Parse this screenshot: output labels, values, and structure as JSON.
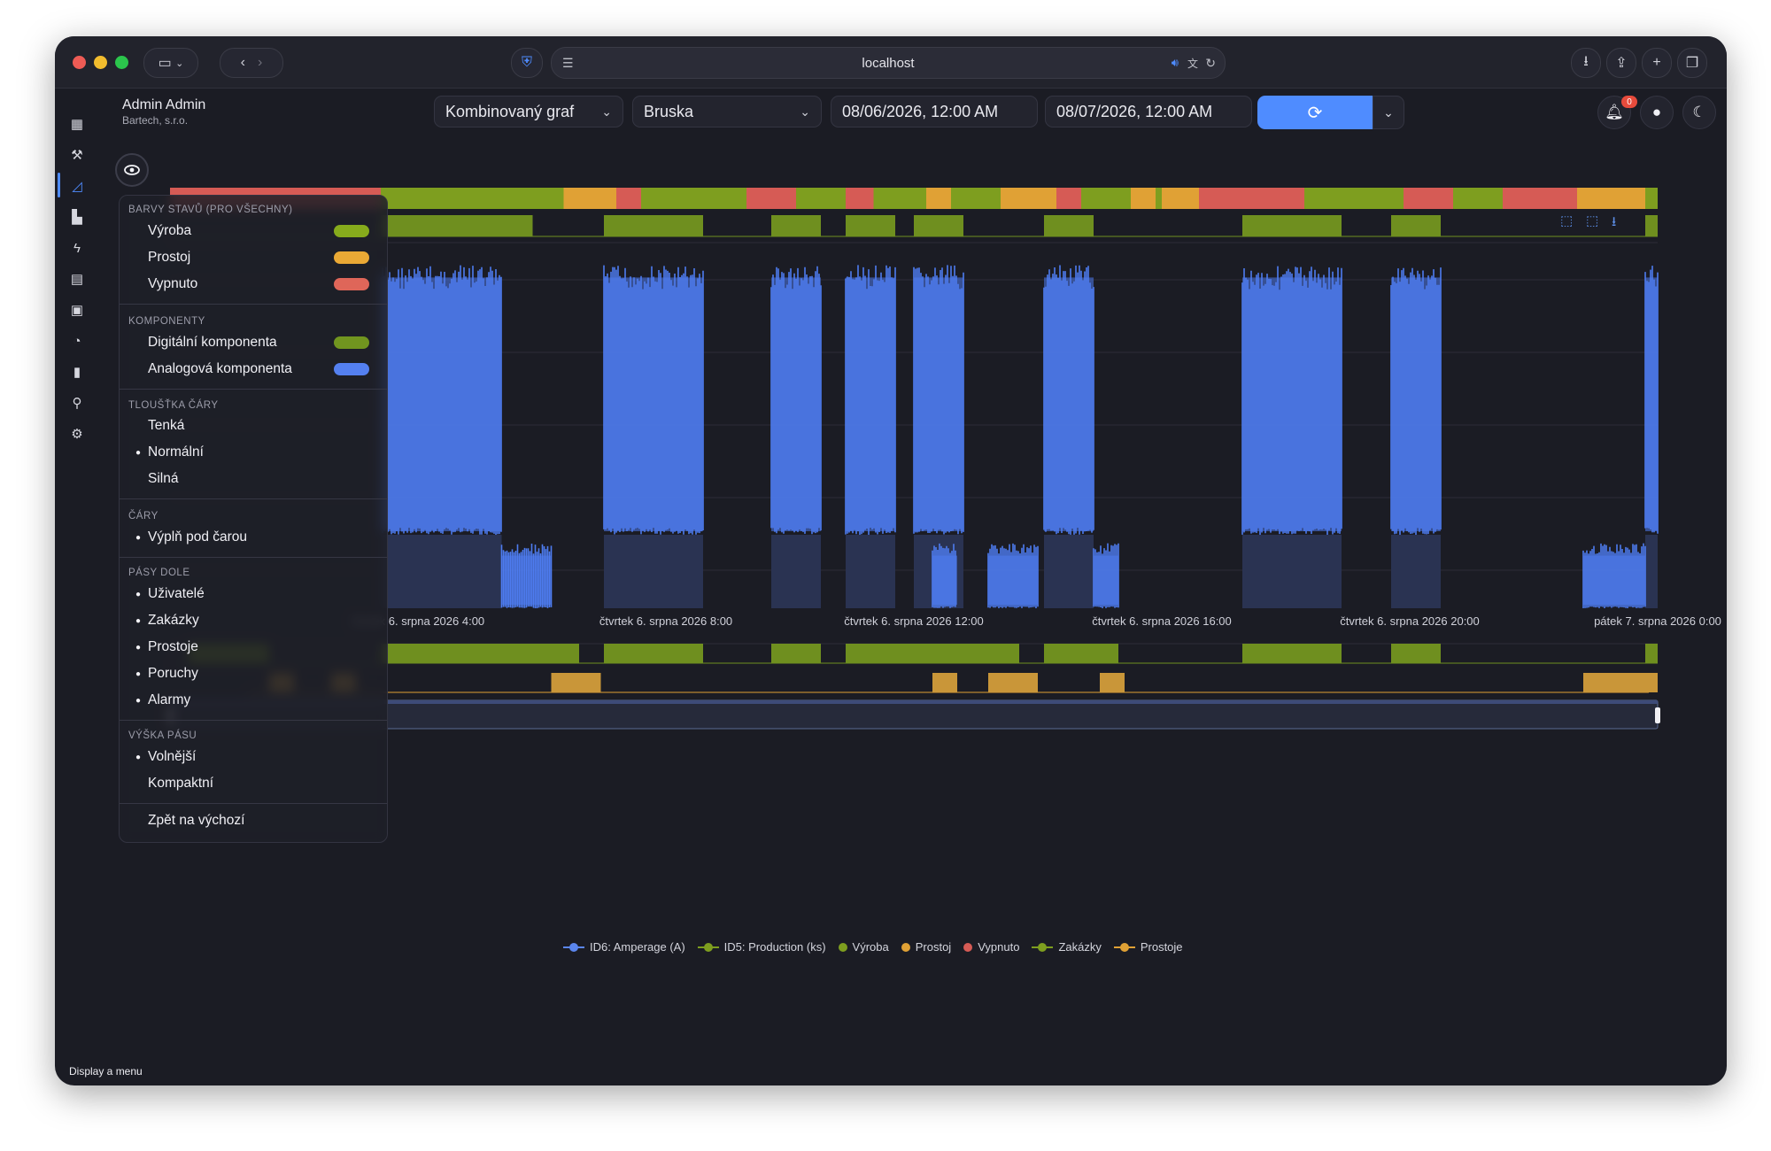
{
  "browser": {
    "url": "localhost"
  },
  "user": {
    "name": "Admin Admin",
    "company": "Bartech, s.r.o."
  },
  "toolbar": {
    "chart_type": "Kombinovaný graf",
    "machine": "Bruska",
    "date_from": "08/06/2026, 12:00 AM",
    "date_to": "08/07/2026, 12:00 AM",
    "notification_count": "0"
  },
  "colors": {
    "vyroba": "#7e9e1f",
    "prostoj": "#e0a135",
    "vypnuto": "#d65b55",
    "digital": "#6f8f1f",
    "analog": "#4e7cf0",
    "accent": "#4f8cff"
  },
  "menu": {
    "section_state_colors": "BARVY STAVŮ (PRO VŠECHNY)",
    "state_vyroba": "Výroba",
    "state_prostoj": "Prostoj",
    "state_vypnuto": "Vypnuto",
    "section_components": "KOMPONENTY",
    "comp_digital": "Digitální komponenta",
    "comp_analog": "Analogová komponenta",
    "section_line_width": "TLOUŠŤKA ČÁRY",
    "lw_thin": "Tenká",
    "lw_normal": "Normální",
    "lw_strong": "Silná",
    "section_lines": "ČÁRY",
    "lines_fill": "Výplň pod čarou",
    "section_bottom_bands": "PÁSY DOLE",
    "band_users": "Uživatelé",
    "band_orders": "Zakázky",
    "band_downtimes": "Prostoje",
    "band_failures": "Poruchy",
    "band_alarms": "Alarmy",
    "section_band_height": "VÝŠKA PÁSU",
    "bh_loose": "Volnější",
    "bh_compact": "Kompaktní",
    "reset": "Zpět na výchozí"
  },
  "chart_data": {
    "type": "area",
    "x_ticks": [
      "čtvrtek 6. srpna 2026 4:00",
      "čtvrtek 6. srpna 2026 8:00",
      "čtvrtek 6. srpna 2026 12:00",
      "čtvrtek 6. srpna 2026 16:00",
      "čtvrtek 6. srpna 2026 20:00",
      "pátek 7. srpna 2026 0:00"
    ],
    "x_range_hours": [
      0,
      24
    ],
    "state_band": [
      {
        "state": "vypnuto",
        "start": 0.0,
        "end": 3.4
      },
      {
        "state": "vyroba",
        "start": 3.4,
        "end": 6.35
      },
      {
        "state": "prostoj",
        "start": 6.35,
        "end": 7.2
      },
      {
        "state": "vypnuto",
        "start": 7.2,
        "end": 7.6
      },
      {
        "state": "vyroba",
        "start": 7.6,
        "end": 9.3
      },
      {
        "state": "vypnuto",
        "start": 9.3,
        "end": 10.1
      },
      {
        "state": "vyroba",
        "start": 10.1,
        "end": 10.9
      },
      {
        "state": "vypnuto",
        "start": 10.9,
        "end": 11.35
      },
      {
        "state": "vyroba",
        "start": 11.35,
        "end": 12.2
      },
      {
        "state": "prostoj",
        "start": 12.2,
        "end": 12.6
      },
      {
        "state": "vyroba",
        "start": 12.6,
        "end": 13.4
      },
      {
        "state": "prostoj",
        "start": 13.4,
        "end": 14.3
      },
      {
        "state": "vypnuto",
        "start": 14.3,
        "end": 14.7
      },
      {
        "state": "vyroba",
        "start": 14.7,
        "end": 15.5
      },
      {
        "state": "prostoj",
        "start": 15.5,
        "end": 15.9
      },
      {
        "state": "vyroba",
        "start": 15.9,
        "end": 16.0
      },
      {
        "state": "prostoj",
        "start": 16.0,
        "end": 16.6
      },
      {
        "state": "vypnuto",
        "start": 16.6,
        "end": 18.3
      },
      {
        "state": "vyroba",
        "start": 18.3,
        "end": 19.9
      },
      {
        "state": "vypnuto",
        "start": 19.9,
        "end": 20.7
      },
      {
        "state": "vyroba",
        "start": 20.7,
        "end": 21.5
      },
      {
        "state": "vypnuto",
        "start": 21.5,
        "end": 22.7
      },
      {
        "state": "prostoj",
        "start": 22.7,
        "end": 23.8
      },
      {
        "state": "vyroba",
        "start": 23.8,
        "end": 24.0
      }
    ],
    "production_blocks": [
      [
        3.4,
        5.85
      ],
      [
        7.0,
        8.6
      ],
      [
        9.7,
        10.5
      ],
      [
        10.9,
        11.7
      ],
      [
        12.0,
        12.8
      ],
      [
        14.1,
        14.9
      ],
      [
        17.3,
        18.9
      ],
      [
        19.7,
        20.5
      ],
      [
        23.8,
        24.0
      ]
    ],
    "series": [
      {
        "name": "ID6: Amperage (A)",
        "high_bursts": [
          [
            3.4,
            5.35
          ],
          [
            7.0,
            8.6
          ],
          [
            9.7,
            10.5
          ],
          [
            10.9,
            11.7
          ],
          [
            12.0,
            12.8
          ],
          [
            14.1,
            14.9
          ],
          [
            17.3,
            18.9
          ],
          [
            19.7,
            20.5
          ],
          [
            23.8,
            24.0
          ]
        ],
        "high_level": 95,
        "low_bursts": [
          [
            5.35,
            6.15
          ],
          [
            12.3,
            12.7
          ],
          [
            13.2,
            14.0
          ],
          [
            14.9,
            15.3
          ],
          [
            22.8,
            23.8
          ]
        ],
        "low_level": 18
      },
      {
        "name": "ID5: Production (ks)"
      }
    ],
    "bottom_orders": [
      [
        0.3,
        1.6
      ],
      [
        3.4,
        6.6
      ],
      [
        7.0,
        8.6
      ],
      [
        9.7,
        10.5
      ],
      [
        10.9,
        13.7
      ],
      [
        14.1,
        15.3
      ],
      [
        17.3,
        18.9
      ],
      [
        19.7,
        20.5
      ],
      [
        23.8,
        24.0
      ]
    ],
    "bottom_downtimes": [
      [
        1.6,
        2.0
      ],
      [
        2.6,
        3.0
      ],
      [
        6.15,
        6.95
      ],
      [
        12.3,
        12.7
      ],
      [
        13.2,
        14.0
      ],
      [
        15.0,
        15.4
      ],
      [
        22.8,
        24.0
      ]
    ],
    "legend": [
      "ID6: Amperage (A)",
      "ID5: Production (ks)",
      "Výroba",
      "Prostoj",
      "Vypnuto",
      "Zakázky",
      "Prostoje"
    ]
  },
  "status_text": "Display a menu"
}
